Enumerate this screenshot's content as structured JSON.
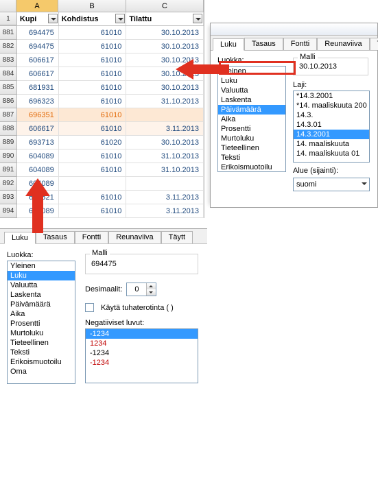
{
  "columns": {
    "rownum": "",
    "A": "A",
    "B": "B",
    "C": "C"
  },
  "filters": {
    "rownum": "1",
    "A": "Kupi",
    "B": "Kohdistus",
    "C": "Tilattu"
  },
  "rows": [
    {
      "n": "881",
      "a": "694475",
      "b": "61010",
      "c": "30.10.2013",
      "cls": ""
    },
    {
      "n": "882",
      "a": "694475",
      "b": "61010",
      "c": "30.10.2013",
      "cls": ""
    },
    {
      "n": "883",
      "a": "606617",
      "b": "61010",
      "c": "30.10.2013",
      "cls": ""
    },
    {
      "n": "884",
      "a": "606617",
      "b": "61010",
      "c": "30.10.2013",
      "cls": ""
    },
    {
      "n": "885",
      "a": "681931",
      "b": "61010",
      "c": "30.10.2013",
      "cls": ""
    },
    {
      "n": "886",
      "a": "696323",
      "b": "61010",
      "c": "31.10.2013",
      "cls": ""
    },
    {
      "n": "887",
      "a": "696351",
      "b": "61010",
      "c": "",
      "cls": "hl-orange"
    },
    {
      "n": "888",
      "a": "606617",
      "b": "61010",
      "c": "3.11.2013",
      "cls": "hl-peach"
    },
    {
      "n": "889",
      "a": "693713",
      "b": "61020",
      "c": "30.10.2013",
      "cls": ""
    },
    {
      "n": "890",
      "a": "604089",
      "b": "61010",
      "c": "31.10.2013",
      "cls": ""
    },
    {
      "n": "891",
      "a": "604089",
      "b": "61010",
      "c": "31.10.2013",
      "cls": ""
    },
    {
      "n": "892",
      "a": "604089",
      "b": "",
      "c": "",
      "cls": ""
    },
    {
      "n": "893",
      "a": "606521",
      "b": "61010",
      "c": "3.11.2013",
      "cls": ""
    },
    {
      "n": "894",
      "a": "604089",
      "b": "61010",
      "c": "3.11.2013",
      "cls": ""
    }
  ],
  "rightDialog": {
    "tabs": [
      "Luku",
      "Tasaus",
      "Fontti",
      "Reunaviiva",
      "T"
    ],
    "activeTab": 0,
    "luokkaLabel": "Luokka:",
    "categories": [
      "Yleinen",
      "Luku",
      "Valuutta",
      "Laskenta",
      "Päivämäärä",
      "Aika",
      "Prosentti",
      "Murtoluku",
      "Tieteellinen",
      "Teksti",
      "Erikoismuotoilu",
      "Oma"
    ],
    "selCategory": 4,
    "malliLabel": "Malli",
    "malliValue": "30.10.2013",
    "lajiLabel": "Laji:",
    "types": [
      "*14.3.2001",
      "*14. maaliskuuta 200",
      "14.3.",
      "14.3.01",
      "14.3.2001",
      "14. maaliskuuta",
      "14. maaliskuuta 01"
    ],
    "selType": 4,
    "alueLabel": "Alue (sijainti):",
    "alueValue": "suomi"
  },
  "bottomDialog": {
    "tabs": [
      "Luku",
      "Tasaus",
      "Fontti",
      "Reunaviiva",
      "Täytt"
    ],
    "activeTab": 0,
    "luokkaLabel": "Luokka:",
    "categories": [
      "Yleinen",
      "Luku",
      "Valuutta",
      "Laskenta",
      "Päivämäärä",
      "Aika",
      "Prosentti",
      "Murtoluku",
      "Tieteellinen",
      "Teksti",
      "Erikoismuotoilu",
      "Oma"
    ],
    "selCategory": 1,
    "malliLabel": "Malli",
    "malliValue": "694475",
    "decLabel": "Desimaalit:",
    "decValue": "0",
    "thouLabel": "Käytä tuhaterotinta ( )",
    "negLabel": "Negatiiviset luvut:",
    "negs": [
      {
        "t": "-1234",
        "cls": "sel"
      },
      {
        "t": "1234",
        "cls": "red"
      },
      {
        "t": "-1234",
        "cls": ""
      },
      {
        "t": "-1234",
        "cls": "red"
      }
    ]
  }
}
